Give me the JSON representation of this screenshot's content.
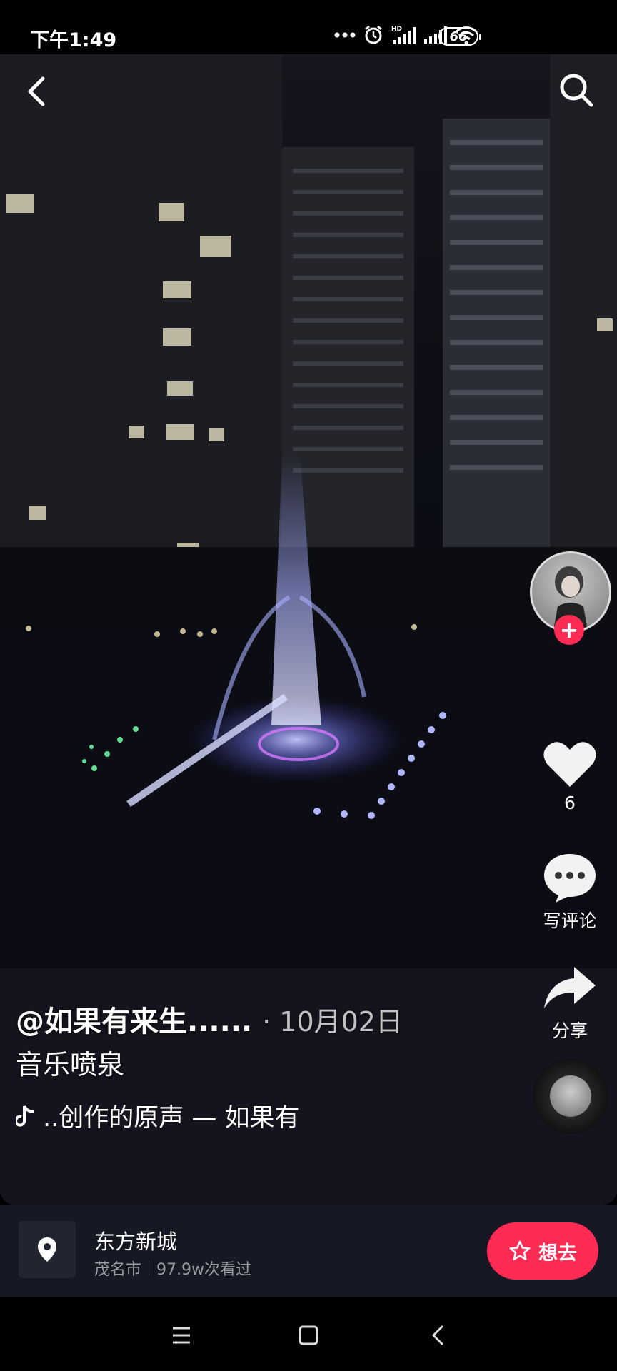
{
  "status_bar": {
    "time": "下午1:49",
    "battery": "66"
  },
  "video": {
    "author": "@如果有来生......",
    "date": "· 10月02日",
    "title": "音乐喷泉",
    "music": "..创作的原声 — 如果有"
  },
  "rail": {
    "likes": "6",
    "comment_label": "写评论",
    "share_label": "分享"
  },
  "location": {
    "name": "东方新城",
    "city": "茂名市",
    "views": "97.9w次看过",
    "want_label": "想去"
  },
  "icons": [
    "back-icon",
    "search-icon",
    "heart-icon",
    "comment-icon",
    "share-icon",
    "location-pin-icon",
    "star-icon",
    "menu-icon",
    "home-icon",
    "nav-back-icon",
    "music-note-icon"
  ],
  "colors": {
    "accent": "#fe2c55",
    "bar_bg": "#161823"
  }
}
